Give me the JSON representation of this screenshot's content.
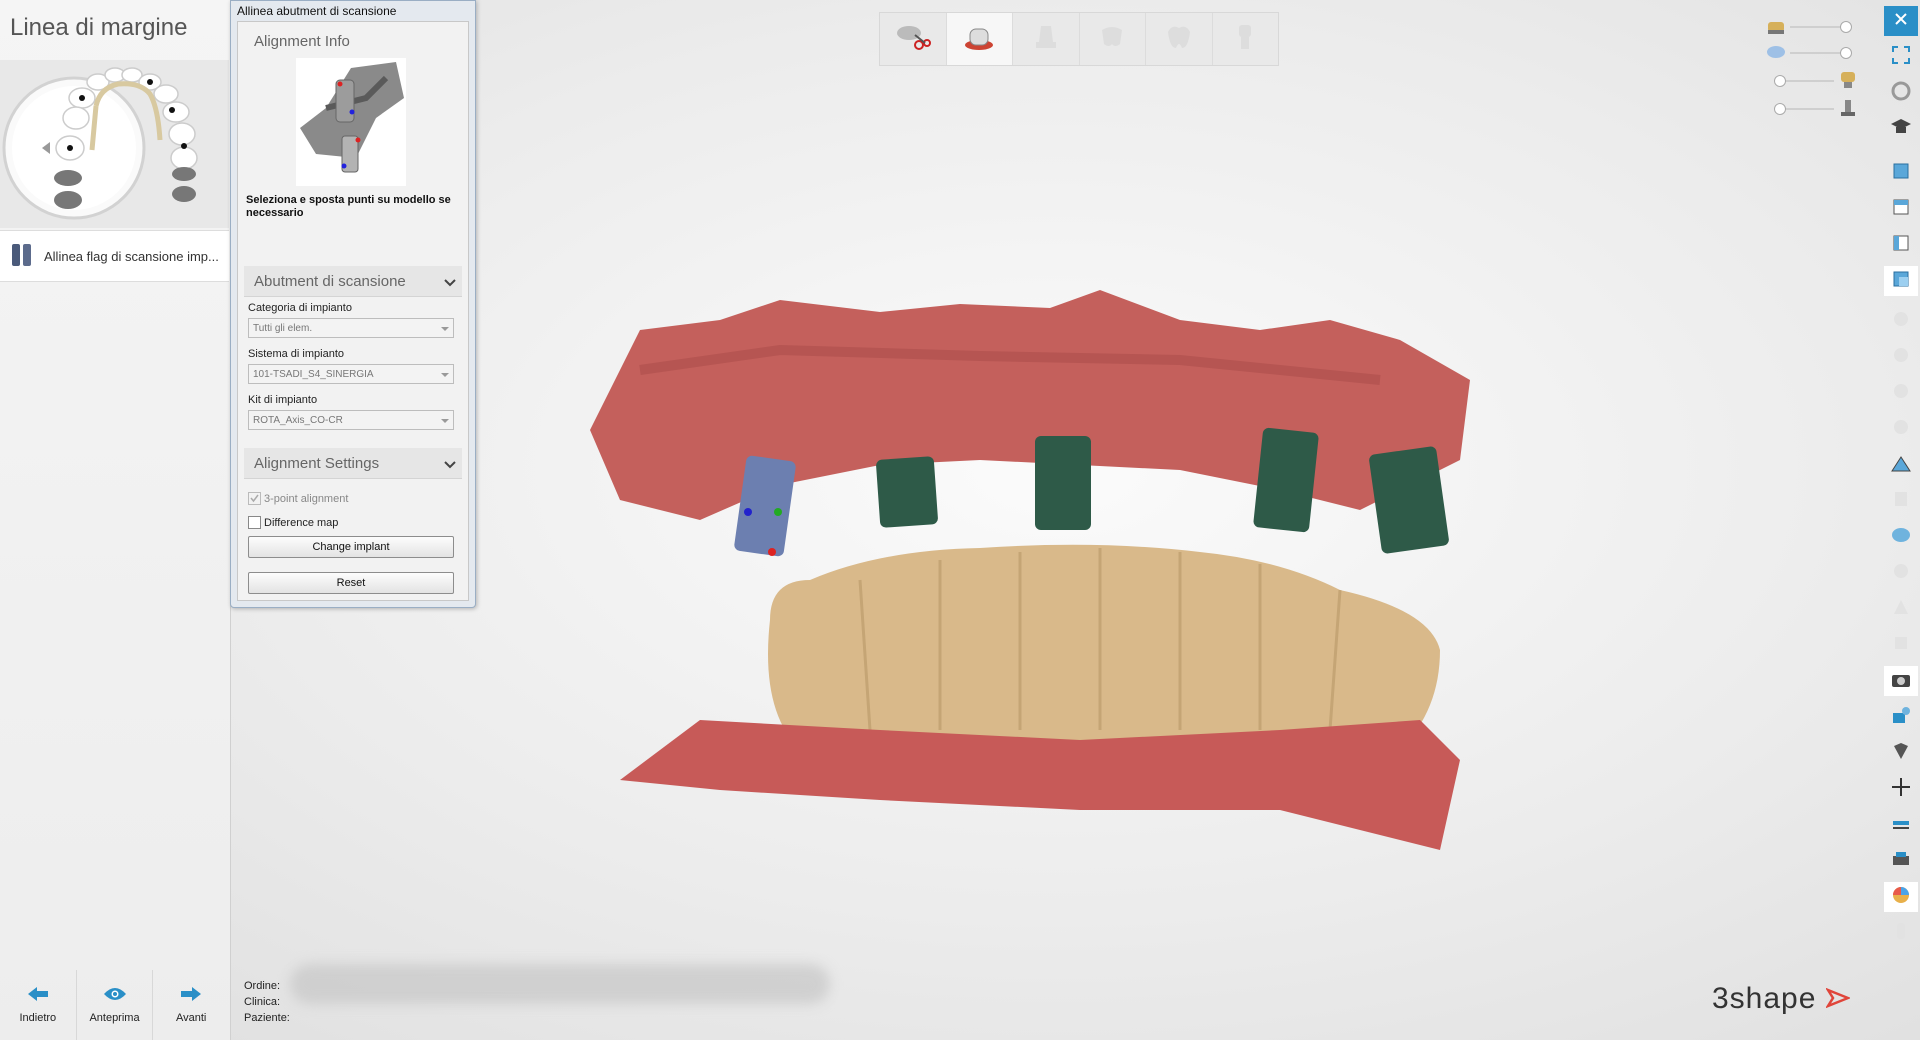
{
  "left_panel": {
    "step_title": "Linea di margine",
    "workflow_item": "Allinea flag di scansione imp...",
    "nav": {
      "back": "Indietro",
      "preview": "Anteprima",
      "next": "Avanti"
    }
  },
  "dialog": {
    "title": "Allinea abutment di scansione",
    "alignment_info": {
      "header": "Alignment Info",
      "instruction": "Seleziona e sposta punti su modello se necessario"
    },
    "scan_abutment": {
      "header": "Abutment di scansione",
      "category_label": "Categoria di impianto",
      "category_value": "Tutti gli elem.",
      "system_label": "Sistema di impianto",
      "system_value": "101-TSADI_S4_SINERGIA",
      "kit_label": "Kit di impianto",
      "kit_value": "ROTA_Axis_CO-CR"
    },
    "alignment_settings": {
      "header": "Alignment Settings",
      "three_point": "3-point alignment",
      "three_point_checked": true,
      "difference_map": "Difference map",
      "difference_map_checked": false,
      "change_implant": "Change implant",
      "reset": "Reset"
    }
  },
  "case_info": {
    "order_label": "Ordine:",
    "clinic_label": "Clinica:",
    "patient_label": "Paziente:"
  },
  "logo": "3shape",
  "colors": {
    "accent": "#2a8fc7",
    "gum": "#c85a5a",
    "tooth": "#d9b98a",
    "abutment": "#2e5a48"
  }
}
